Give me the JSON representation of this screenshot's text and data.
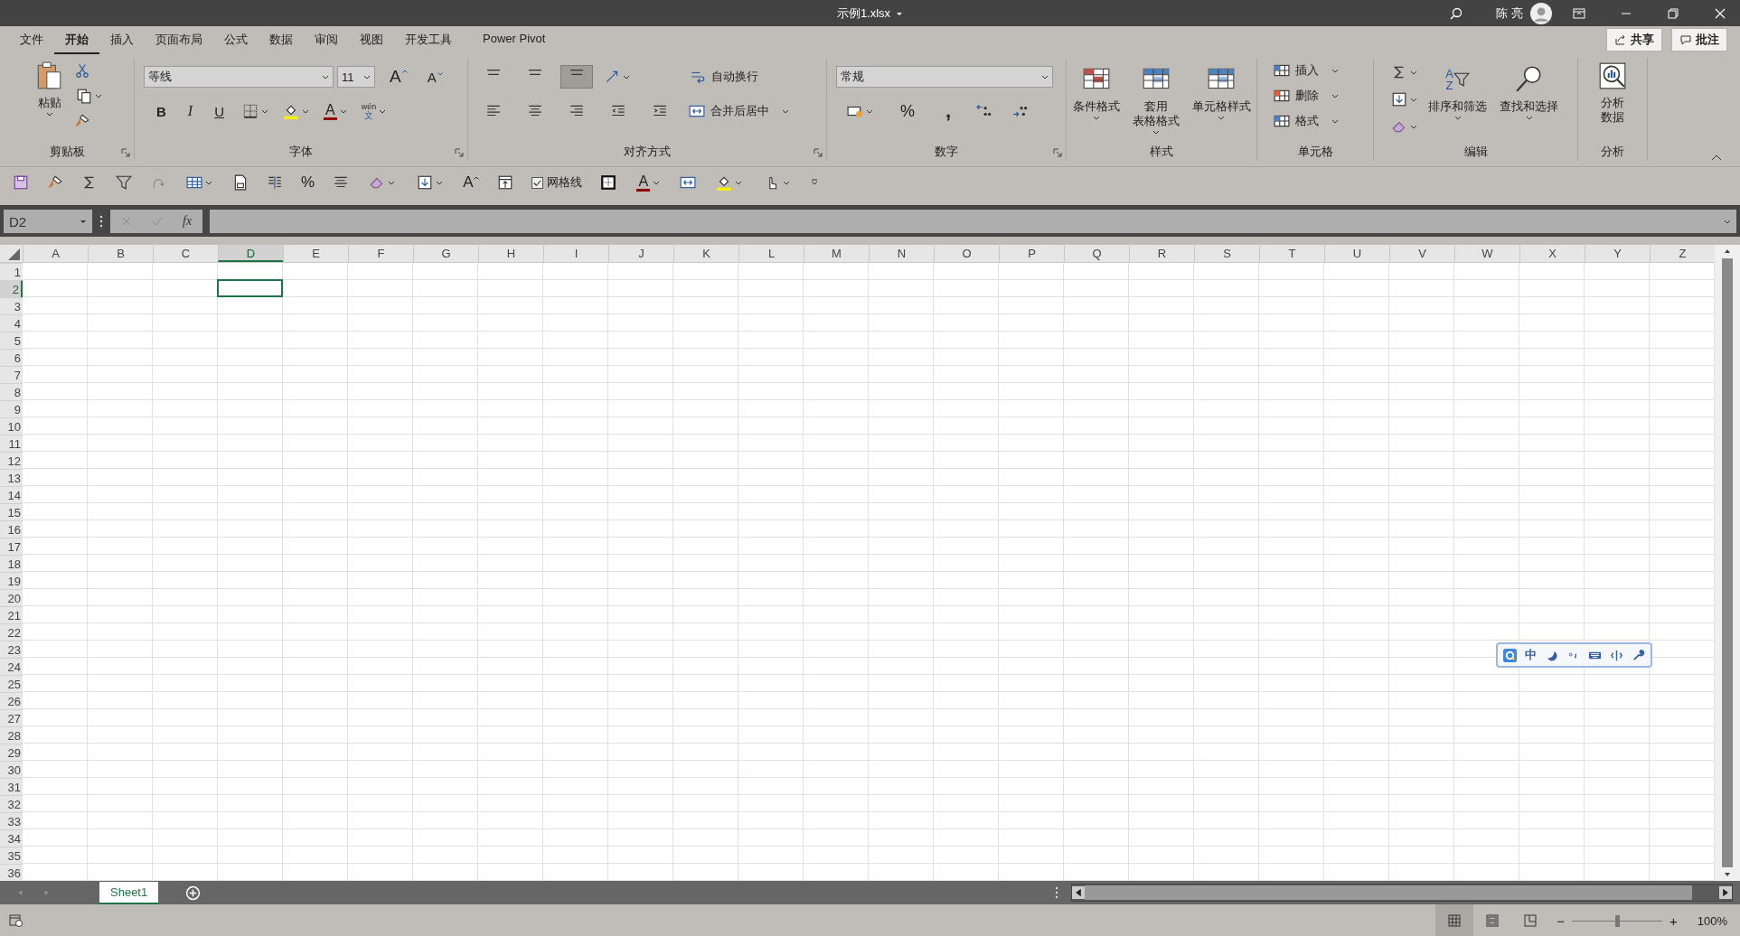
{
  "window": {
    "title": "示例1.xlsx",
    "user": "陈 亮"
  },
  "tabs": [
    {
      "label": "文件",
      "selected": false
    },
    {
      "label": "开始",
      "selected": true
    },
    {
      "label": "插入",
      "selected": false
    },
    {
      "label": "页面布局",
      "selected": false
    },
    {
      "label": "公式",
      "selected": false
    },
    {
      "label": "数据",
      "selected": false
    },
    {
      "label": "审阅",
      "selected": false
    },
    {
      "label": "视图",
      "selected": false
    },
    {
      "label": "开发工具",
      "selected": false
    },
    {
      "label": "Power Pivot",
      "selected": false
    }
  ],
  "header_buttons": [
    "共享",
    "批注"
  ],
  "ribbon": {
    "clipboard": {
      "label": "剪贴板",
      "paste": "粘贴"
    },
    "font": {
      "label": "字体",
      "font_name": "等线",
      "font_size": "11",
      "grow": "A",
      "shrink": "A",
      "bold": "B",
      "italic": "I",
      "underline": "U",
      "font_color": "A",
      "phonetic_top": "wén",
      "phonetic_bottom": "文"
    },
    "alignment": {
      "label": "对齐方式",
      "vertical": [
        {
          "selected": false
        },
        {
          "selected": false
        },
        {
          "selected": true
        }
      ],
      "wrap": "自动换行",
      "merge": "合并后居中"
    },
    "number": {
      "label": "数字",
      "format": "常规",
      "percent": "%",
      "comma": ","
    },
    "styles": {
      "label": "样式",
      "buttons": [
        {
          "lines": [
            "条件格式"
          ]
        },
        {
          "lines": [
            "套用",
            "表格格式"
          ]
        },
        {
          "lines": [
            "单元格样式"
          ]
        }
      ]
    },
    "cells": {
      "label": "单元格",
      "buttons": [
        "插入",
        "删除",
        "格式"
      ]
    },
    "editing": {
      "label": "编辑",
      "sort_letters": [
        "A",
        "Z"
      ],
      "buttons": [
        "排序和筛选",
        "查找和选择"
      ]
    },
    "analysis": {
      "label": "分析",
      "button": [
        "分析",
        "数据"
      ]
    }
  },
  "quick_access": {
    "percent": "%",
    "grow": "A",
    "gridlines": {
      "label": "网格线",
      "checked": true
    },
    "font_color": "A"
  },
  "formula_bar": {
    "name_box": "D2",
    "fx": "fx"
  },
  "sheet": {
    "columns": [
      {
        "label": "A",
        "selected": false
      },
      {
        "label": "B",
        "selected": false
      },
      {
        "label": "C",
        "selected": false
      },
      {
        "label": "D",
        "selected": true
      },
      {
        "label": "E",
        "selected": false
      },
      {
        "label": "F",
        "selected": false
      },
      {
        "label": "G",
        "selected": false
      },
      {
        "label": "H",
        "selected": false
      },
      {
        "label": "I",
        "selected": false
      },
      {
        "label": "J",
        "selected": false
      },
      {
        "label": "K",
        "selected": false
      },
      {
        "label": "L",
        "selected": false
      },
      {
        "label": "M",
        "selected": false
      },
      {
        "label": "N",
        "selected": false
      },
      {
        "label": "O",
        "selected": false
      },
      {
        "label": "P",
        "selected": false
      },
      {
        "label": "Q",
        "selected": false
      },
      {
        "label": "R",
        "selected": false
      },
      {
        "label": "S",
        "selected": false
      },
      {
        "label": "T",
        "selected": false
      },
      {
        "label": "U",
        "selected": false
      },
      {
        "label": "V",
        "selected": false
      },
      {
        "label": "W",
        "selected": false
      },
      {
        "label": "X",
        "selected": false
      },
      {
        "label": "Y",
        "selected": false
      },
      {
        "label": "Z",
        "selected": false
      }
    ],
    "rows": [
      {
        "label": "1",
        "selected": false
      },
      {
        "label": "2",
        "selected": true
      },
      {
        "label": "3",
        "selected": false
      },
      {
        "label": "4",
        "selected": false
      },
      {
        "label": "5",
        "selected": false
      },
      {
        "label": "6",
        "selected": false
      },
      {
        "label": "7",
        "selected": false
      },
      {
        "label": "8",
        "selected": false
      },
      {
        "label": "9",
        "selected": false
      },
      {
        "label": "10",
        "selected": false
      },
      {
        "label": "11",
        "selected": false
      },
      {
        "label": "12",
        "selected": false
      },
      {
        "label": "13",
        "selected": false
      },
      {
        "label": "14",
        "selected": false
      },
      {
        "label": "15",
        "selected": false
      },
      {
        "label": "16",
        "selected": false
      },
      {
        "label": "17",
        "selected": false
      },
      {
        "label": "18",
        "selected": false
      },
      {
        "label": "19",
        "selected": false
      },
      {
        "label": "20",
        "selected": false
      },
      {
        "label": "21",
        "selected": false
      },
      {
        "label": "22",
        "selected": false
      },
      {
        "label": "23",
        "selected": false
      },
      {
        "label": "24",
        "selected": false
      },
      {
        "label": "25",
        "selected": false
      },
      {
        "label": "26",
        "selected": false
      },
      {
        "label": "27",
        "selected": false
      },
      {
        "label": "28",
        "selected": false
      },
      {
        "label": "29",
        "selected": false
      },
      {
        "label": "30",
        "selected": false
      },
      {
        "label": "31",
        "selected": false
      },
      {
        "label": "32",
        "selected": false
      },
      {
        "label": "33",
        "selected": false
      },
      {
        "label": "34",
        "selected": false
      },
      {
        "label": "35",
        "selected": false
      },
      {
        "label": "36",
        "selected": false
      }
    ]
  },
  "sheet_tabs": [
    {
      "name": "Sheet1",
      "selected": true
    }
  ],
  "status_bar": {
    "views": [
      {
        "selected": true
      },
      {
        "selected": false
      },
      {
        "selected": false
      }
    ],
    "zoom_minus": "−",
    "zoom_plus": "+",
    "level": 0.5,
    "zoom": "100%"
  },
  "ime_toolbar": {
    "mode": "中"
  }
}
